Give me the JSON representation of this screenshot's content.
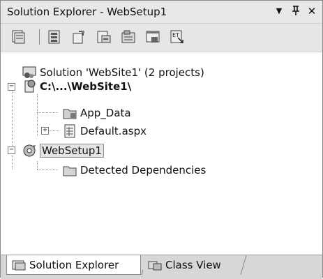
{
  "window": {
    "title": "Solution Explorer - WebSetup1",
    "controls": {
      "dropdown": "▼",
      "pin": "📌",
      "close": "✕"
    }
  },
  "toolbar": {
    "buttons": [
      "properties-icon",
      "show-all-files-icon",
      "refresh-icon",
      "file-system-editor-icon",
      "registry-editor-icon",
      "file-types-editor-icon",
      "user-interface-editor-icon"
    ]
  },
  "tree": {
    "solution": "Solution 'WebSite1' (2 projects)",
    "website": "C:\\...\\WebSite1\\",
    "app_data": "App_Data",
    "default_aspx": "Default.aspx",
    "websetup": "WebSetup1",
    "detected": "Detected Dependencies"
  },
  "tabs": {
    "solution_explorer": "Solution Explorer",
    "class_view": "Class View"
  }
}
